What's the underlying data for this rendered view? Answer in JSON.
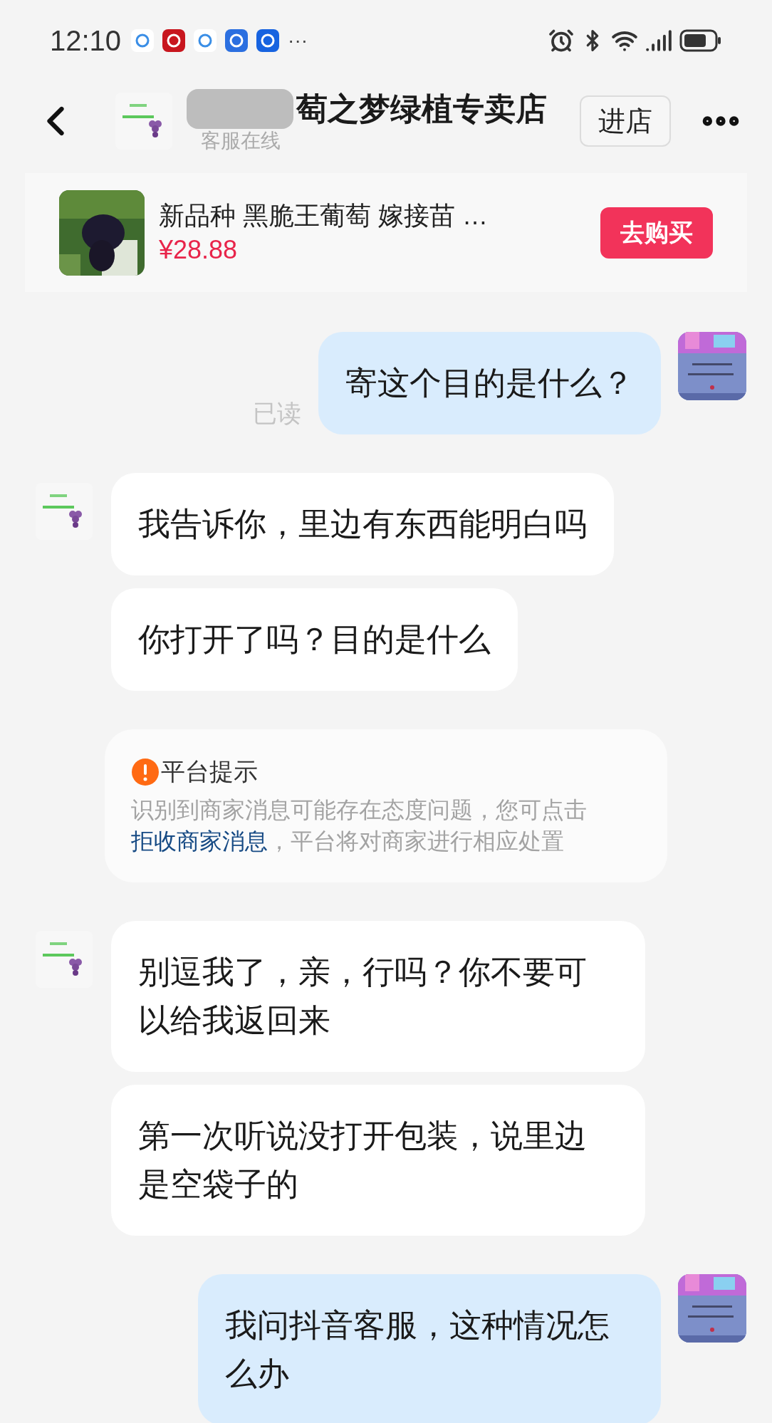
{
  "status_bar": {
    "time": "12:10",
    "more": "···"
  },
  "header": {
    "store_name": "萄之梦绿植专卖店",
    "status": "客服在线",
    "enter_button": "进店"
  },
  "product": {
    "title": "新品种 黑脆王葡萄 嫁接苗 …",
    "price": "¥28.88",
    "buy_button": "去购买"
  },
  "messages": [
    {
      "kind": "outgoing",
      "text": "寄这个目的是什么？",
      "read_receipt": "已读"
    },
    {
      "kind": "incoming",
      "text": "我告诉你，里边有东西能明白吗",
      "avatar": true
    },
    {
      "kind": "incoming",
      "text": "你打开了吗？目的是什么",
      "avatar": false
    },
    {
      "kind": "notice",
      "title": "平台提示",
      "text": "识别到商家消息可能存在态度问题，您可点击",
      "link": "拒收商家消息",
      "text_after": "，平台将对商家进行相应处置"
    },
    {
      "kind": "incoming",
      "text": "别逗我了，亲，行吗？你不要可以给我返回来",
      "avatar": true
    },
    {
      "kind": "incoming",
      "text": "第一次听说没打开包装，说里边是空袋子的",
      "avatar": false
    },
    {
      "kind": "outgoing",
      "text": "我问抖音客服，这种情况怎么办"
    }
  ]
}
